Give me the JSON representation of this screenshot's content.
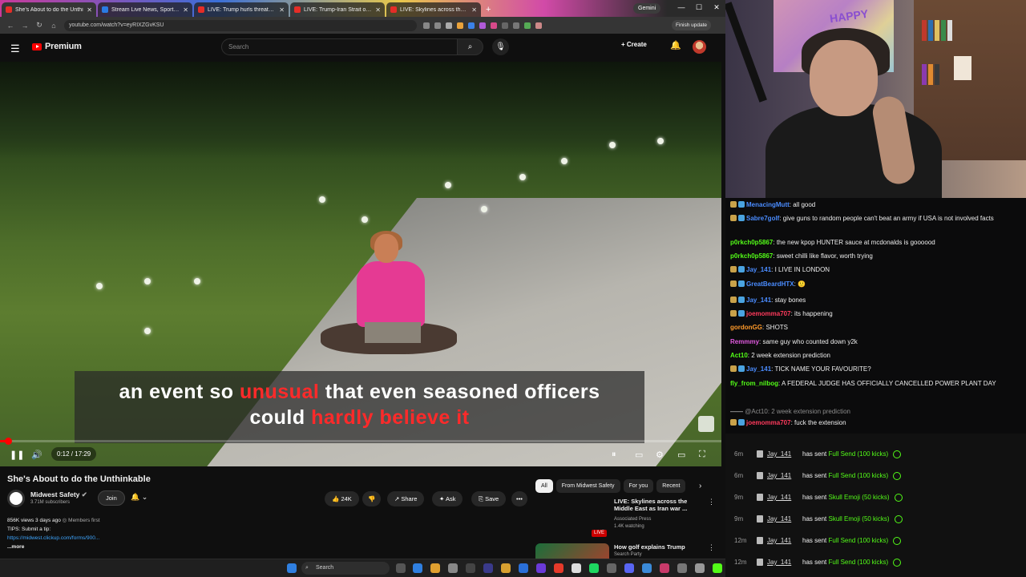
{
  "browser": {
    "tabs": [
      {
        "title": "She's About to do the Unthi",
        "active": true
      },
      {
        "title": "Stream Live News, Sports, a",
        "active": false
      },
      {
        "title": "LIVE: Trump hurls threats as se",
        "active": false
      },
      {
        "title": "LIVE: Trump-Iran Strait of Horm",
        "active": false
      },
      {
        "title": "LIVE: Skylines across the Middl",
        "active": false
      }
    ],
    "new_tab": "+",
    "gemini": "Gemini",
    "url": "youtube.com/watch?v=eyRIXZGvKSU",
    "finish_update": "Finish update"
  },
  "youtube": {
    "logo": "Premium",
    "search_placeholder": "Search",
    "create": "Create",
    "video": {
      "caption_line1_a": "an event so ",
      "caption_line1_hl": "unusual",
      "caption_line1_b": " that even seasoned officers",
      "caption_line2_a": "could ",
      "caption_line2_hl": "hardly believe it",
      "time": "0:12 / 17:29",
      "progress_fraction": 0.0114
    },
    "title": "She's About to do the Unthinkable",
    "channel": "Midwest Safety",
    "subscribers": "3.71M subscribers",
    "join": "Join",
    "likes": "24K",
    "share": "Share",
    "ask": "Ask",
    "save": "Save",
    "more_actions": "•••",
    "description": {
      "meta": "856K views  3 days ago",
      "members": "Members first",
      "tips": "TIPS: Submit a tip:",
      "link": "https://midwest.clickup.com/forms/900...",
      "more": "...more"
    },
    "chips": [
      "All",
      "From Midwest Safety",
      "For you",
      "Recent"
    ],
    "recommendations": [
      {
        "title": "LIVE: Skylines across the Middle East as Iran war ...",
        "channel": "Associated Press",
        "meta": "1.4K watching",
        "badge": "LIVE"
      },
      {
        "title": "How golf explains Trump",
        "channel": "Search Party",
        "meta": ""
      }
    ]
  },
  "taskbar": {
    "search": "Search"
  },
  "webcam": {
    "wall_text": "HAPPY"
  },
  "chat": [
    {
      "user": "MenacingMutt",
      "color": "#4a8cff",
      "msg": "all good"
    },
    {
      "user": "Sabre7golf",
      "color": "#4a8cff",
      "msg": "give guns to random people can't beat an army if USA is not involved facts"
    },
    {
      "user": "p0rkch0p5867",
      "color": "#53fc18",
      "msg": "the new kpop HUNTER sauce at mcdonalds is goooood"
    },
    {
      "user": "p0rkch0p5867",
      "color": "#53fc18",
      "msg": "sweet chilli like flavor, worth trying"
    },
    {
      "user": "Jay_141",
      "color": "#4a8cff",
      "msg": "I LIVE IN LONDON"
    },
    {
      "user": "GreatBeardHTX",
      "color": "#4a8cff",
      "msg": "🙂"
    },
    {
      "user": "Jay_141",
      "color": "#4a8cff",
      "msg": "stay bones"
    },
    {
      "user": "joemomma707",
      "color": "#ff3a5c",
      "msg": "its happening"
    },
    {
      "user": "gordonGG",
      "color": "#ff9a2a",
      "msg": "SHOTS"
    },
    {
      "user": "Remmmy",
      "color": "#e05adf",
      "msg": "same guy who counted down y2k"
    },
    {
      "user": "Act10",
      "color": "#53fc18",
      "msg": "2 week extension prediction"
    },
    {
      "user": "Jay_141",
      "color": "#4a8cff",
      "msg": "TICK NAME YOUR FAVOURITE?"
    },
    {
      "user": "fly_from_nilbog",
      "color": "#53fc18",
      "msg": "A FEDERAL JUDGE HAS OFFICIALLY CANCELLED POWER PLANT DAY"
    },
    {
      "reply": "@Act10: 2 week extension prediction"
    },
    {
      "user": "joemomma707",
      "color": "#ff3a5c",
      "msg": "fuck the extension"
    }
  ],
  "kicks": [
    {
      "time": "6m",
      "user": "Jay_141",
      "sent": "has sent",
      "gift": "Full Send (100 kicks)"
    },
    {
      "time": "6m",
      "user": "Jay_141",
      "sent": "has sent",
      "gift": "Full Send (100 kicks)"
    },
    {
      "time": "9m",
      "user": "Jay_141",
      "sent": "has sent",
      "gift": "Skull Emoji (50 kicks)"
    },
    {
      "time": "9m",
      "user": "Jay_141",
      "sent": "has sent",
      "gift": "Skull Emoji (50 kicks)"
    },
    {
      "time": "12m",
      "user": "Jay_141",
      "sent": "has sent",
      "gift": "Full Send (100 kicks)"
    },
    {
      "time": "12m",
      "user": "Jay_141",
      "sent": "has sent",
      "gift": "Full Send (100 kicks)"
    }
  ]
}
